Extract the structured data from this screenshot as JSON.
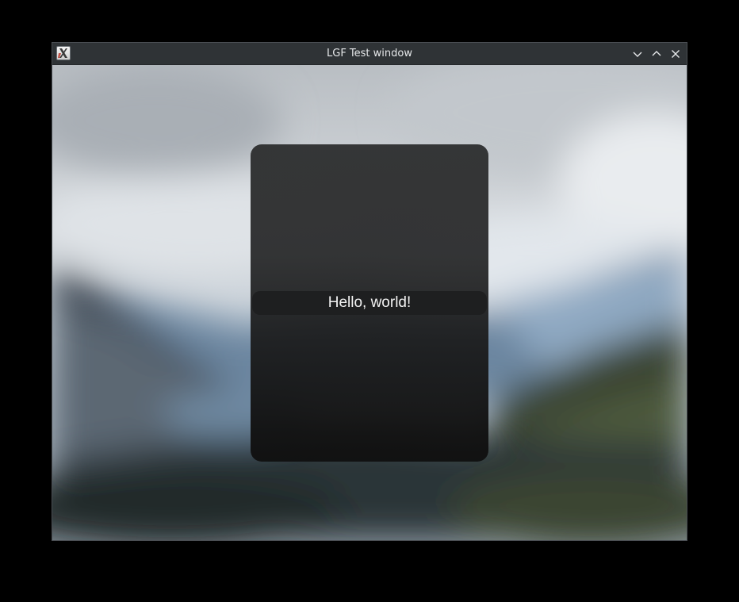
{
  "window": {
    "title": "LGF Test window",
    "controls": [
      "minimize",
      "maximize",
      "close"
    ]
  },
  "card": {
    "label": "Hello, world!"
  },
  "colors": {
    "desktop": "#000000",
    "titlebar": "#2f3336",
    "title_text": "#e6e8ea",
    "card": "#2c2d2e",
    "label_text": "#f2f2f2"
  },
  "icons": {
    "app": "x11-icon",
    "minimize": "chevron-down-icon",
    "maximize": "chevron-up-icon",
    "close": "close-icon"
  }
}
